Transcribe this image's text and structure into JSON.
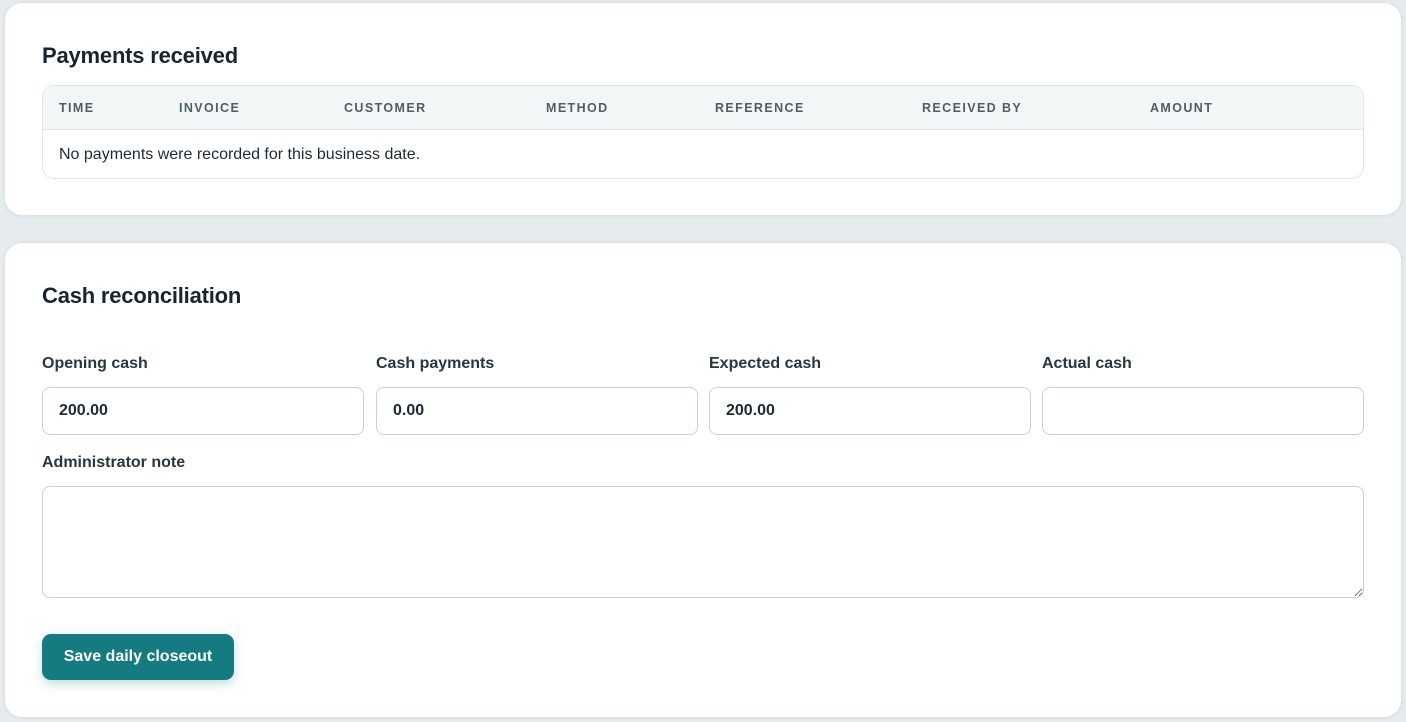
{
  "payments": {
    "title": "Payments received",
    "columns": [
      "TIME",
      "INVOICE",
      "CUSTOMER",
      "METHOD",
      "REFERENCE",
      "RECEIVED BY",
      "AMOUNT"
    ],
    "empty_message": "No payments were recorded for this business date."
  },
  "cash": {
    "title": "Cash reconciliation",
    "fields": [
      {
        "label": "Opening cash",
        "value": "200.00"
      },
      {
        "label": "Cash payments",
        "value": "0.00"
      },
      {
        "label": "Expected cash",
        "value": "200.00"
      },
      {
        "label": "Actual cash",
        "value": ""
      }
    ],
    "note_label": "Administrator note",
    "note_value": "",
    "save_label": "Save daily closeout"
  },
  "colors": {
    "accent": "#147c80",
    "background": "#e6eced",
    "table_header_bg": "#f3f6f7"
  }
}
